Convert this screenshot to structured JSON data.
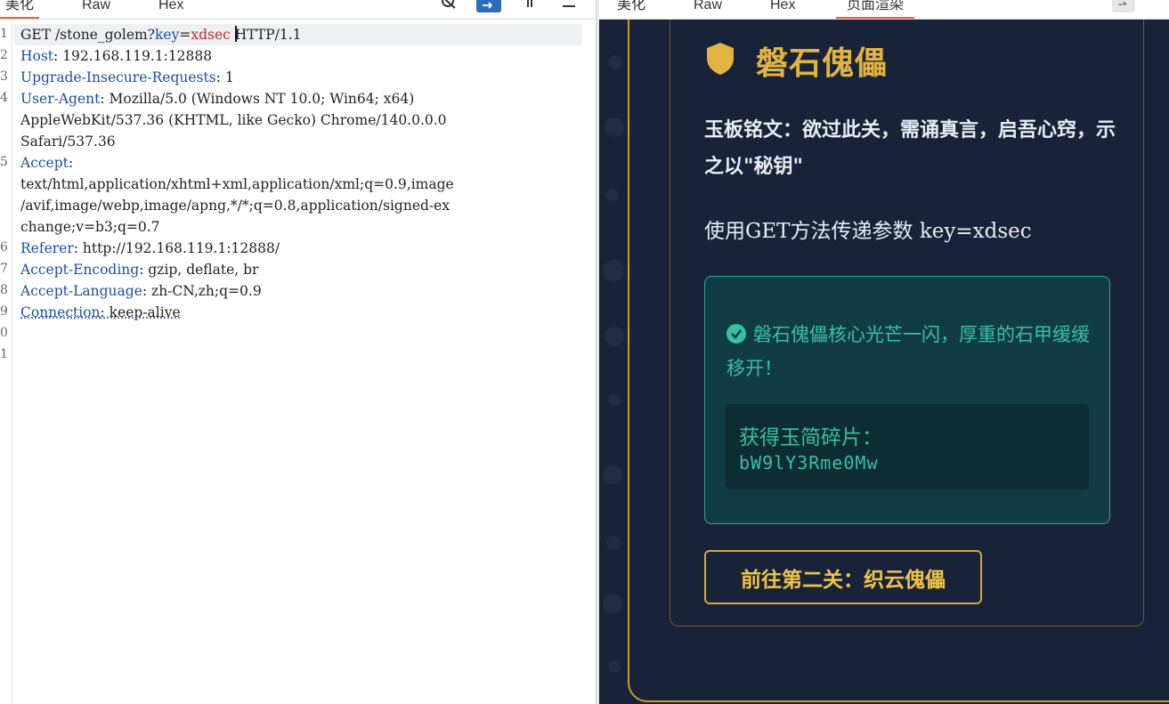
{
  "left_tabs": [
    "美化",
    "Raw",
    "Hex"
  ],
  "right_tabs": [
    "美化",
    "Raw",
    "Hex",
    "页面渲染"
  ],
  "icons": {
    "hide": "eye-off-icon",
    "wrap": "wrap-lines-icon",
    "newline": "newline-icon",
    "menu": "menu-icon",
    "right_wrap": "wrap-lines-icon"
  },
  "request": {
    "line_numbers": [
      "1",
      "2",
      "3",
      "4",
      "5",
      "6",
      "7",
      "8",
      "9",
      "0",
      "1"
    ],
    "method": "GET /stone_golem?",
    "param_key": "key",
    "param_eq": "=",
    "param_value": "xdsec",
    "protocol": "HTTP/1.1",
    "host_name": "Host",
    "host_value": ": 192.168.119.1:12888",
    "uir_name": "Upgrade-Insecure-Requests",
    "uir_value": ": 1",
    "ua_name": "User-Agent",
    "ua_value": ": Mozilla/5.0 (Windows NT 10.0; Win64; x64)",
    "ua_cont1": "AppleWebKit/537.36 (KHTML, like Gecko) Chrome/140.0.0.0",
    "ua_cont2": "Safari/537.36",
    "accept_name": "Accept",
    "accept_sep": ":",
    "accept_cont1": "text/html,application/xhtml+xml,application/xml;q=0.9,image",
    "accept_cont2": "/avif,image/webp,image/apng,*/*;q=0.8,application/signed-ex",
    "accept_cont3": "change;v=b3;q=0.7",
    "referer_name": "Referer",
    "referer_value": ": http://192.168.119.1:12888/",
    "ae_name": "Accept-Encoding",
    "ae_value": ": gzip, deflate, br",
    "al_name": "Accept-Language",
    "al_value": ": zh-CN,zh;q=0.9",
    "conn_name": "Connection",
    "conn_value": ": keep-alive"
  },
  "page": {
    "title": "磐石傀儡",
    "inscription": "玉板铭文：欲过此关，需诵真言，启吾心窍，示之以\"秘钥\"",
    "hint": "使用GET方法传递参数 key=xdsec",
    "success_message": "磐石傀儡核心光芒一闪，厚重的石甲缓缓移开！",
    "fragment_label": "获得玉简碎片：",
    "fragment_value": "bW9lY3Rme0Mw",
    "next_button": "前往第二关：织云傀儡"
  },
  "colors": {
    "accent_gold": "#e2b340",
    "success_green": "#37c0a3",
    "bg_dark": "#18233a",
    "tab_active": "#e8613a"
  }
}
